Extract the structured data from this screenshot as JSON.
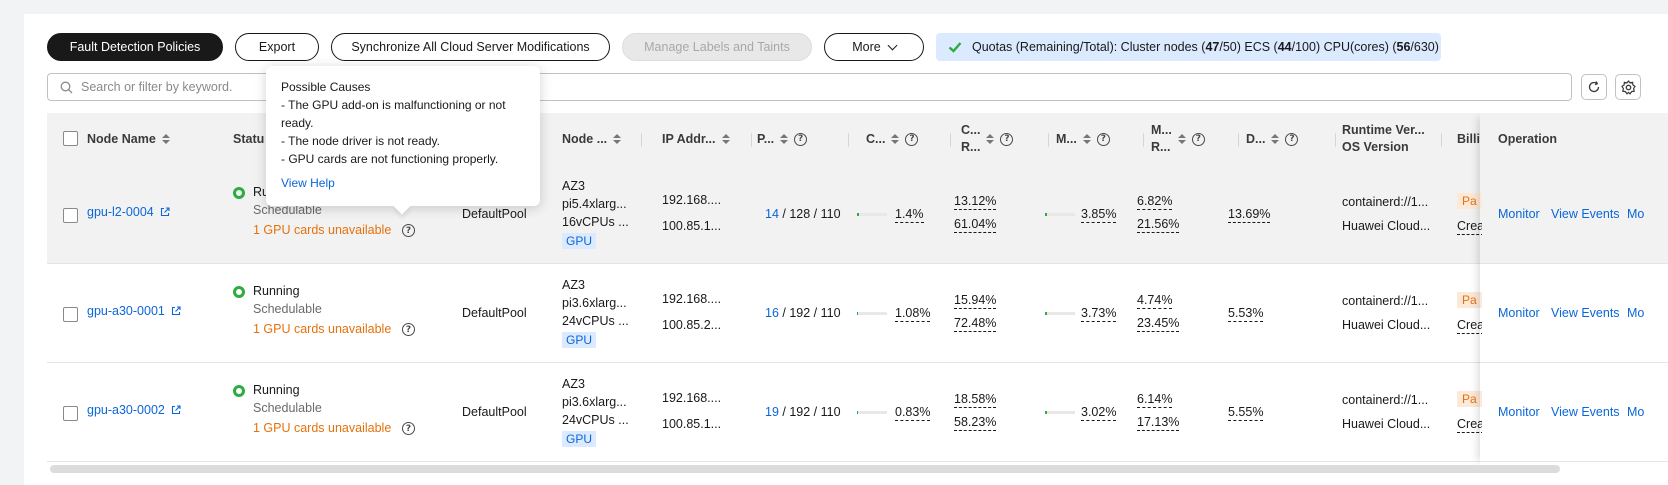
{
  "toolbar": {
    "fault_detection": "Fault Detection Policies",
    "export": "Export",
    "sync": "Synchronize All Cloud Server Modifications",
    "manage_labels": "Manage Labels and Taints",
    "more": "More"
  },
  "quota": {
    "prefix": "Quotas (Remaining/Total): Cluster nodes (",
    "nodes_remaining": "47",
    "nodes_total": "/50) ECS (",
    "ecs_remaining": "44",
    "ecs_total": "/100) CPU(cores) (",
    "cpu_remaining": "56",
    "cpu_total": "/630)"
  },
  "search": {
    "placeholder": "Search or filter by keyword."
  },
  "columns": {
    "node_name": "Node Name",
    "status": "Statu",
    "node_type": "Node ...",
    "ip": "IP Addr...",
    "pods": "P...",
    "cpu": "C...",
    "cpu_req_1": "C...",
    "cpu_req_2": "R...",
    "mem": "M...",
    "mem_req_1": "M...",
    "mem_req_2": "R...",
    "disk": "D...",
    "runtime_1": "Runtime Ver...",
    "runtime_2": "OS Version",
    "billing": "Billi",
    "operation": "Operation"
  },
  "tooltip": {
    "title": "Possible Causes",
    "line1": "- The GPU add-on is malfunctioning or not ready.",
    "line2": "- The node driver is not ready.",
    "line3": "- GPU cards are not functioning properly.",
    "link": "View Help"
  },
  "rows": [
    {
      "name": "gpu-l2-0004",
      "status": "Ru",
      "schedulable": "Schedulable",
      "gpu_warning": "1 GPU cards unavailable",
      "pool": "DefaultPool",
      "az": "AZ3",
      "flavor": "pi5.4xlarg...",
      "spec": "16vCPUs ...",
      "gpu_tag": "GPU",
      "ip1": "192.168....",
      "ip2": "100.85.1...",
      "pods_used": "14",
      "pods_rest": " / 128 / 110",
      "cpu": "1.4%",
      "cpu_fill": 0.05,
      "cpu_req1": "13.12%",
      "cpu_req2": "61.04%",
      "mem": "3.85%",
      "mem_fill": 0.06,
      "mem_req1": "6.82%",
      "mem_req2": "21.56%",
      "disk": "13.69%",
      "runtime": "containerd://1...",
      "os": "Huawei Cloud...",
      "billing_tag": "Pa",
      "billing_sub": "Crea",
      "op_monitor": "Monitor",
      "op_events": "View Events",
      "op_more": "Mo"
    },
    {
      "name": "gpu-a30-0001",
      "status": "Running",
      "schedulable": "Schedulable",
      "gpu_warning": "1 GPU cards unavailable",
      "pool": "DefaultPool",
      "az": "AZ3",
      "flavor": "pi3.6xlarg...",
      "spec": "24vCPUs ...",
      "gpu_tag": "GPU",
      "ip1": "192.168....",
      "ip2": "100.85.2...",
      "pods_used": "16",
      "pods_rest": " / 192 / 110",
      "cpu": "1.08%",
      "cpu_fill": 0.04,
      "cpu_req1": "15.94%",
      "cpu_req2": "72.48%",
      "mem": "3.73%",
      "mem_fill": 0.06,
      "mem_req1": "4.74%",
      "mem_req2": "23.45%",
      "disk": "5.53%",
      "runtime": "containerd://1...",
      "os": "Huawei Cloud...",
      "billing_tag": "Pa",
      "billing_sub": "Crea",
      "op_monitor": "Monitor",
      "op_events": "View Events",
      "op_more": "Mo"
    },
    {
      "name": "gpu-a30-0002",
      "status": "Running",
      "schedulable": "Schedulable",
      "gpu_warning": "1 GPU cards unavailable",
      "pool": "DefaultPool",
      "az": "AZ3",
      "flavor": "pi3.6xlarg...",
      "spec": "24vCPUs ...",
      "gpu_tag": "GPU",
      "ip1": "192.168....",
      "ip2": "100.85.1...",
      "pods_used": "19",
      "pods_rest": " / 192 / 110",
      "cpu": "0.83%",
      "cpu_fill": 0.03,
      "cpu_req1": "18.58%",
      "cpu_req2": "58.23%",
      "mem": "3.02%",
      "mem_fill": 0.05,
      "mem_req1": "6.14%",
      "mem_req2": "17.13%",
      "disk": "5.55%",
      "runtime": "containerd://1...",
      "os": "Huawei Cloud...",
      "billing_tag": "Pa",
      "billing_sub": "Crea",
      "op_monitor": "Monitor",
      "op_events": "View Events",
      "op_more": "Mo"
    }
  ],
  "colors": {
    "accent": "#0a66d9",
    "running": "#2dac3f",
    "warning": "#e6710c",
    "primary": "#191919"
  }
}
